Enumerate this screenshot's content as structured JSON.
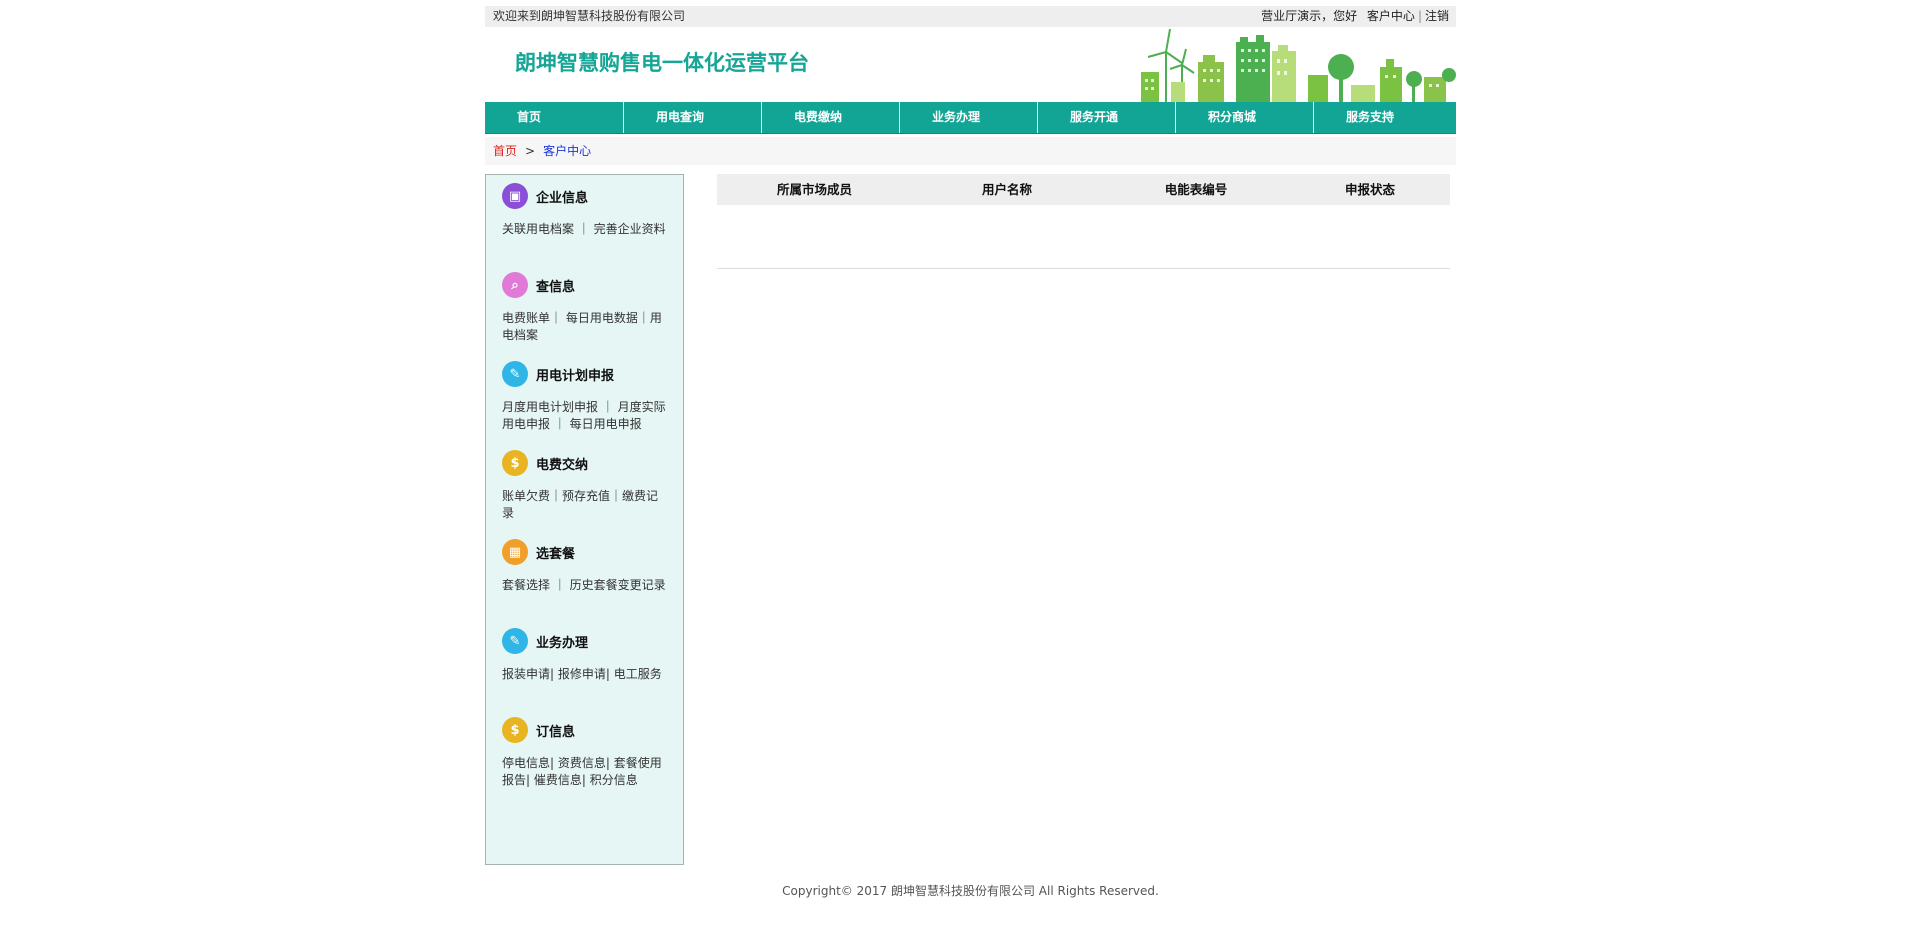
{
  "topbar": {
    "welcome": "欢迎来到朗坤智慧科技股份有限公司",
    "user": "营业厅演示，您好",
    "center": "客户中心",
    "sep": "|",
    "logout": "注销"
  },
  "header": {
    "logo": "朗坤智慧购售电一体化运营平台"
  },
  "nav": [
    {
      "label": "首页"
    },
    {
      "label": "用电查询"
    },
    {
      "label": "电费缴纳"
    },
    {
      "label": "业务办理"
    },
    {
      "label": "服务开通"
    },
    {
      "label": "积分商城"
    },
    {
      "label": "服务支持"
    }
  ],
  "breadcrumb": {
    "home": "首页",
    "arrow": ">",
    "current": "客户中心"
  },
  "sidebar": [
    {
      "title": "企业信息",
      "icon": "enterprise-icon",
      "color": "#8a4fd6",
      "links": "关联用电档案 ｜ 完善企业资料"
    },
    {
      "title": "查信息",
      "icon": "search-doc-icon",
      "color": "#e07ad6",
      "links": "电费账单｜ 每日用电数据｜用电档案"
    },
    {
      "title": "用电计划申报",
      "icon": "edit-doc-icon",
      "color": "#2fb6e6",
      "links": "月度用电计划申报 ｜ 月度实际用电申报 ｜ 每日用电申报"
    },
    {
      "title": "电费交纳",
      "icon": "dollar-icon",
      "color": "#e8b422",
      "links": "账单欠费｜预存充值｜缴费记录"
    },
    {
      "title": "选套餐",
      "icon": "gift-icon",
      "color": "#f0a02a",
      "links": "套餐选择 ｜ 历史套餐变更记录"
    },
    {
      "title": "业务办理",
      "icon": "edit-doc-icon",
      "color": "#2fb6e6",
      "links": "报装申请|  报修申请|  电工服务"
    },
    {
      "title": "订信息",
      "icon": "dollar-icon",
      "color": "#e8b422",
      "links": "停电信息|  资费信息|  套餐使用报告|  催费信息|  积分信息"
    }
  ],
  "table": {
    "headers": [
      "所属市场成员",
      "用户名称",
      "电能表编号",
      "申报状态"
    ]
  },
  "footer": "Copyright© 2017 朗坤智慧科技股份有限公司 All Rights Reserved."
}
